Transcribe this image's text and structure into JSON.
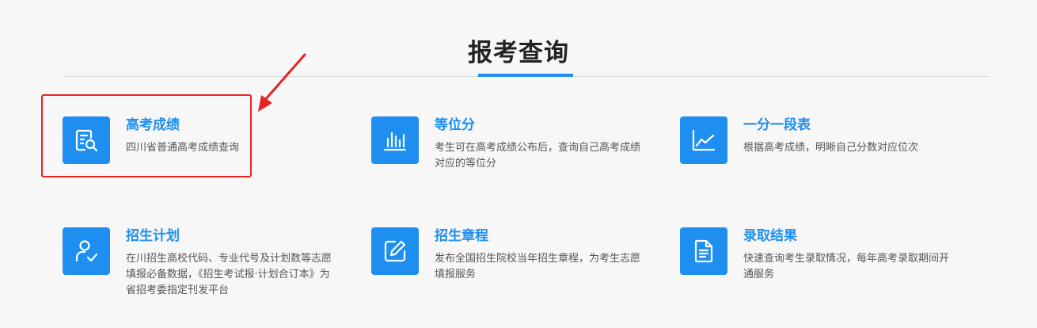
{
  "section": {
    "title": "报考查询"
  },
  "cards": [
    {
      "title": "高考成绩",
      "desc": "四川省普通高考成绩查询",
      "icon": "report-search-icon"
    },
    {
      "title": "等位分",
      "desc": "考生可在高考成绩公布后，查询自己高考成绩对应的等位分",
      "icon": "bar-chart-icon"
    },
    {
      "title": "一分一段表",
      "desc": "根据高考成绩，明晰自己分数对应位次",
      "icon": "line-chart-icon"
    },
    {
      "title": "招生计划",
      "desc": "在川招生高校代码、专业代号及计划数等志愿填报必备数据，《招生考试报·计划合订本》为省招考委指定刊发平台",
      "icon": "user-check-icon"
    },
    {
      "title": "招生章程",
      "desc": "发布全国招生院校当年招生章程，为考生志愿填报服务",
      "icon": "edit-icon"
    },
    {
      "title": "录取结果",
      "desc": "快速查询考生录取情况，每年高考录取期间开通服务",
      "icon": "document-icon"
    }
  ],
  "colors": {
    "accent": "#1e8ff0",
    "highlight": "#e52424",
    "background": "#f7f7f8"
  }
}
